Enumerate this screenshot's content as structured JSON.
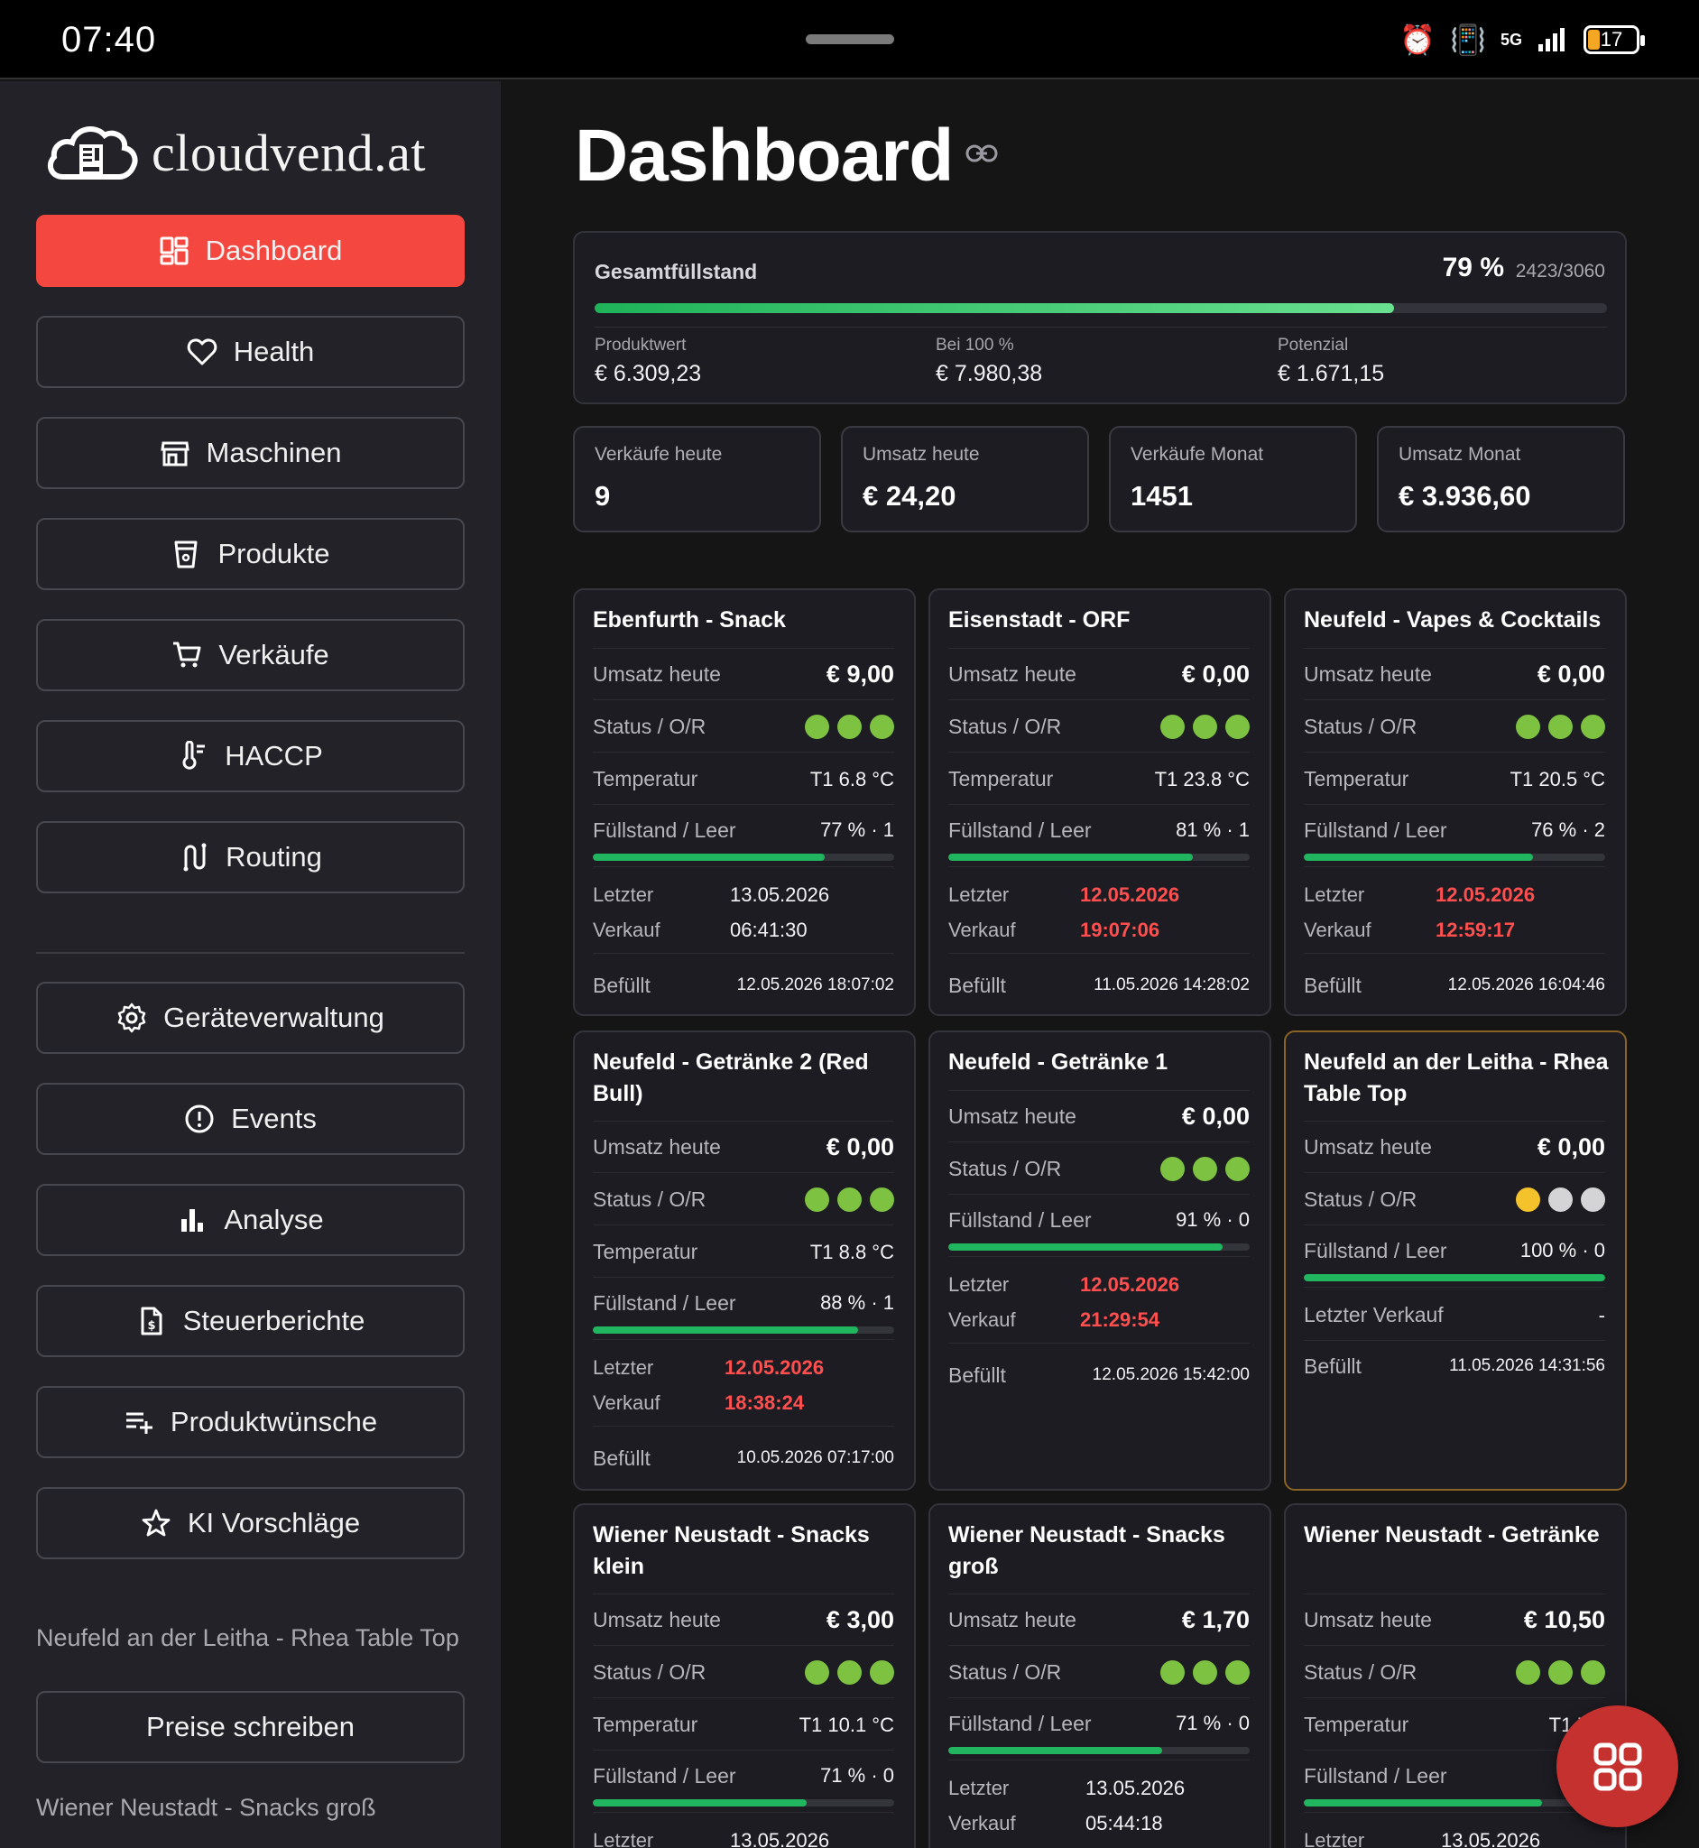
{
  "statusbar": {
    "time": "07:40",
    "network": "5G",
    "battery": "17"
  },
  "sidebar": {
    "brand": "cloudvend.at",
    "nav": [
      {
        "label": "Dashboard",
        "icon": "dashboard-grid-icon",
        "active": true
      },
      {
        "label": "Health",
        "icon": "heart-icon"
      },
      {
        "label": "Maschinen",
        "icon": "storefront-icon"
      },
      {
        "label": "Produkte",
        "icon": "cup-icon"
      },
      {
        "label": "Verkäufe",
        "icon": "cart-icon"
      },
      {
        "label": "HACCP",
        "icon": "thermometer-icon"
      },
      {
        "label": "Routing",
        "icon": "route-icon"
      }
    ],
    "nav2": [
      {
        "label": "Geräteverwaltung",
        "icon": "gear-icon"
      },
      {
        "label": "Events",
        "icon": "alert-circle-icon"
      },
      {
        "label": "Analyse",
        "icon": "bar-chart-icon"
      },
      {
        "label": "Steuerberichte",
        "icon": "document-icon"
      },
      {
        "label": "Produktwünsche",
        "icon": "playlist-add-icon"
      },
      {
        "label": "KI Vorschläge",
        "icon": "star-icon"
      }
    ],
    "note1": "Neufeld an der Leitha - Rhea Table Top",
    "write_prices": "Preise schreiben",
    "note2": "Wiener Neustadt - Snacks groß"
  },
  "main": {
    "title": "Dashboard",
    "fill": {
      "label": "Gesamtfüllstand",
      "percent_label": "79 %",
      "percent": 79,
      "count": "2423/3060",
      "stats": [
        {
          "label": "Produktwert",
          "value": "€ 6.309,23"
        },
        {
          "label": "Bei 100 %",
          "value": "€ 7.980,38"
        },
        {
          "label": "Potenzial",
          "value": "€ 1.671,15"
        }
      ]
    },
    "kpis": [
      {
        "label": "Verkäufe heute",
        "value": "9"
      },
      {
        "label": "Umsatz heute",
        "value": "€ 24,20"
      },
      {
        "label": "Verkäufe Monat",
        "value": "1451"
      },
      {
        "label": "Umsatz Monat",
        "value": "€ 3.936,60"
      }
    ],
    "row_labels": {
      "revenue": "Umsatz heute",
      "status": "Status / O/R",
      "temperature": "Temperatur",
      "fill": "Füllstand / Leer",
      "last_top": "Letzter",
      "last_bottom": "Verkauf",
      "last_single": "Letzter Verkauf",
      "filled": "Befüllt"
    },
    "machines": [
      {
        "name": "Ebenfurth - Snack",
        "revenue": "€ 9,00",
        "status": [
          "green",
          "green",
          "green"
        ],
        "temperature": "T1 6.8 °C",
        "fill_label": "77 % · 1",
        "fill": 77,
        "last_date": "13.05.2026",
        "last_time": "06:41:30",
        "last_stale": false,
        "filled": "12.05.2026 18:07:02"
      },
      {
        "name": "Eisenstadt - ORF",
        "revenue": "€ 0,00",
        "status": [
          "green",
          "green",
          "green"
        ],
        "temperature": "T1 23.8 °C",
        "fill_label": "81 % · 1",
        "fill": 81,
        "last_date": "12.05.2026",
        "last_time": "19:07:06",
        "last_stale": true,
        "filled": "11.05.2026 14:28:02"
      },
      {
        "name": "Neufeld - Vapes & Cocktails",
        "revenue": "€ 0,00",
        "status": [
          "green",
          "green",
          "green"
        ],
        "temperature": "T1 20.5 °C",
        "fill_label": "76 % · 2",
        "fill": 76,
        "last_date": "12.05.2026",
        "last_time": "12:59:17",
        "last_stale": true,
        "filled": "12.05.2026 16:04:46"
      },
      {
        "name": "Neufeld - Getränke 2 (Red Bull)",
        "revenue": "€ 0,00",
        "status": [
          "green",
          "green",
          "green"
        ],
        "temperature": "T1 8.8 °C",
        "fill_label": "88 % · 1",
        "fill": 88,
        "last_date": "12.05.2026",
        "last_time": "18:38:24",
        "last_stale": true,
        "filled": "10.05.2026 07:17:00"
      },
      {
        "name": "Neufeld - Getränke 1",
        "revenue": "€ 0,00",
        "status": [
          "green",
          "green",
          "green"
        ],
        "fill_label": "91 % · 0",
        "fill": 91,
        "last_date": "12.05.2026",
        "last_time": "21:29:54",
        "last_stale": true,
        "filled": "12.05.2026 15:42:00"
      },
      {
        "name": "Neufeld an der Leitha - Rhea Table Top",
        "revenue": "€ 0,00",
        "status": [
          "yellow",
          "white",
          "white"
        ],
        "fill_label": "100 % · 0",
        "fill": 100,
        "last_none": "-",
        "filled": "11.05.2026 14:31:56"
      },
      {
        "name": "Wiener Neustadt - Snacks klein",
        "revenue": "€ 3,00",
        "status": [
          "green",
          "green",
          "green"
        ],
        "temperature": "T1 10.1 °C",
        "fill_label": "71 % · 0",
        "fill": 71,
        "last_date": "13.05.2026"
      },
      {
        "name": "Wiener Neustadt - Snacks groß",
        "revenue": "€ 1,70",
        "status": [
          "green",
          "green",
          "green"
        ],
        "fill_label": "71 % · 0",
        "fill": 71,
        "last_date": "13.05.2026",
        "last_time": "05:44:18"
      },
      {
        "name": "Wiener Neustadt - Getränke",
        "revenue": "€ 10,50",
        "status": [
          "green",
          "green",
          "green"
        ],
        "temperature": "T1 7.7",
        "fill_label": "79",
        "fill": 79,
        "last_date": "13.05.2026"
      }
    ]
  },
  "colors": {
    "accent": "#f4473f",
    "green": "#7ec242",
    "bar": "#22b55f",
    "stale": "#ff4f4f",
    "warn_border": "#8a6326"
  }
}
